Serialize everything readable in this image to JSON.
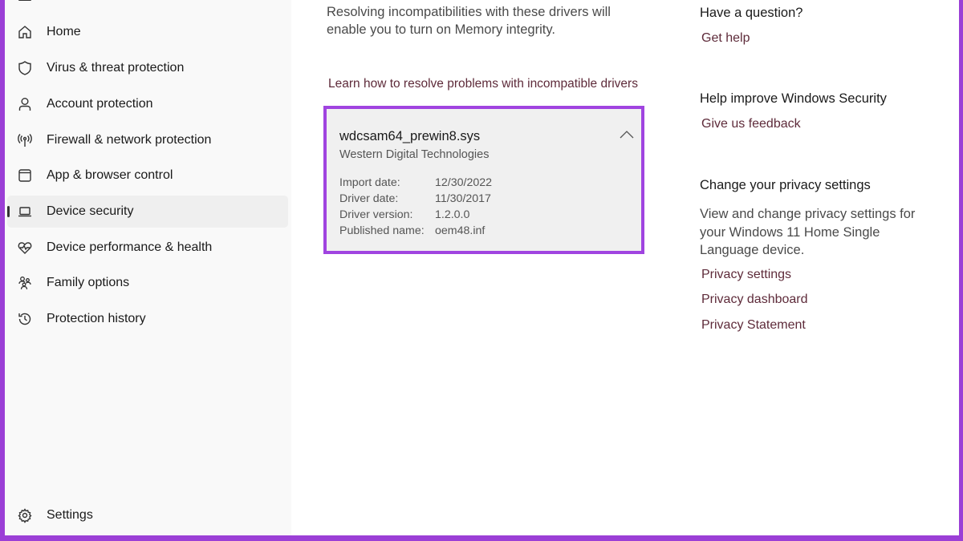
{
  "sidebar": {
    "items": [
      {
        "label": "Home",
        "icon": "home-icon",
        "active": false
      },
      {
        "label": "Virus & threat protection",
        "icon": "shield-icon",
        "active": false
      },
      {
        "label": "Account protection",
        "icon": "person-icon",
        "active": false
      },
      {
        "label": "Firewall & network protection",
        "icon": "antenna-icon",
        "active": false
      },
      {
        "label": "App & browser control",
        "icon": "app-window-icon",
        "active": false
      },
      {
        "label": "Device security",
        "icon": "laptop-icon",
        "active": true
      },
      {
        "label": "Device performance & health",
        "icon": "heart-pulse-icon",
        "active": false
      },
      {
        "label": "Family options",
        "icon": "family-icon",
        "active": false
      },
      {
        "label": "Protection history",
        "icon": "history-icon",
        "active": false
      }
    ],
    "settings_label": "Settings"
  },
  "main": {
    "description": "Resolving incompatibilities with these drivers will enable you to turn on Memory integrity.",
    "learn_link": "Learn how to resolve problems with incompatible drivers",
    "driver": {
      "name": "wdcsam64_prewin8.sys",
      "company": "Western Digital Technologies",
      "details": [
        {
          "key": "Import date:",
          "value": "12/30/2022"
        },
        {
          "key": "Driver date:",
          "value": "11/30/2017"
        },
        {
          "key": "Driver version:",
          "value": "1.2.0.0"
        },
        {
          "key": "Published name:",
          "value": "oem48.inf"
        }
      ]
    }
  },
  "right": {
    "question_heading": "Have a question?",
    "get_help": "Get help",
    "improve_heading": "Help improve Windows Security",
    "feedback": "Give us feedback",
    "privacy_heading": "Change your privacy settings",
    "privacy_text": "View and change privacy settings for your Windows 11 Home Single Language device.",
    "privacy_settings": "Privacy settings",
    "privacy_dashboard": "Privacy dashboard",
    "privacy_statement": "Privacy Statement"
  },
  "colors": {
    "highlight_border": "#a044e0",
    "frame": "#9b3fd6",
    "link": "#5e2b3a"
  }
}
